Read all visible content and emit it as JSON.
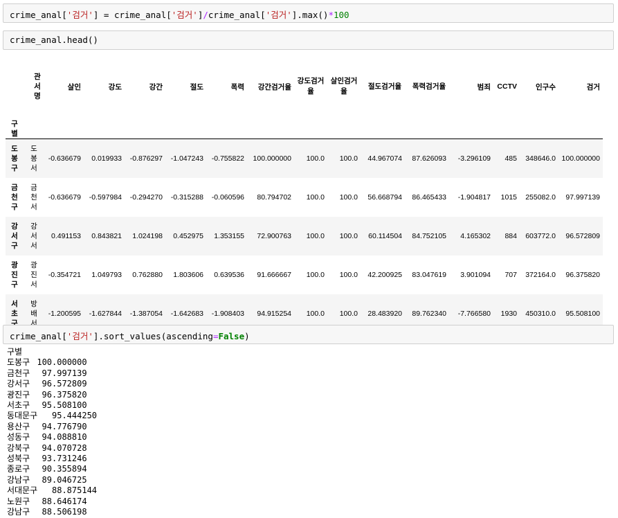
{
  "cells": {
    "cell1_code": {
      "var": "crime_anal",
      "key": "'검거'",
      "max_call": ".max()",
      "mult": "*",
      "num": "100"
    },
    "cell2_code": "crime_anal.head()",
    "cell3_code": {
      "var": "crime_anal",
      "key": "'검거'",
      "method": "].sort_values(ascending",
      "eq": "=",
      "kw": "False",
      "close": ")"
    }
  },
  "dataframe": {
    "index_name": "구별",
    "columns": [
      "관서명",
      "살인",
      "강도",
      "강간",
      "절도",
      "폭력",
      "강간검거율",
      "강도검거율",
      "살인검거율",
      "절도검거율",
      "폭력검거율",
      "범죄",
      "CCTV",
      "인구수",
      "검거"
    ],
    "rows": [
      [
        "도봉구",
        "도봉서",
        "-0.636679",
        "0.019933",
        "-0.876297",
        "-1.047243",
        "-0.755822",
        "100.000000",
        "100.0",
        "100.0",
        "44.967074",
        "87.626093",
        "-3.296109",
        "485",
        "348646.0",
        "100.000000"
      ],
      [
        "금천구",
        "금천서",
        "-0.636679",
        "-0.597984",
        "-0.294270",
        "-0.315288",
        "-0.060596",
        "80.794702",
        "100.0",
        "100.0",
        "56.668794",
        "86.465433",
        "-1.904817",
        "1015",
        "255082.0",
        "97.997139"
      ],
      [
        "강서구",
        "강서서",
        "0.491153",
        "0.843821",
        "1.024198",
        "0.452975",
        "1.353155",
        "72.900763",
        "100.0",
        "100.0",
        "60.114504",
        "84.752105",
        "4.165302",
        "884",
        "603772.0",
        "96.572809"
      ],
      [
        "광진구",
        "광진서",
        "-0.354721",
        "1.049793",
        "0.762880",
        "1.803606",
        "0.639536",
        "91.666667",
        "100.0",
        "100.0",
        "42.200925",
        "83.047619",
        "3.901094",
        "707",
        "372164.0",
        "96.375820"
      ],
      [
        "서초구",
        "방배서",
        "-1.200595",
        "-1.627844",
        "-1.387054",
        "-1.642683",
        "-1.908403",
        "94.915254",
        "100.0",
        "100.0",
        "28.483920",
        "89.762340",
        "-7.766580",
        "1930",
        "450310.0",
        "95.508100"
      ]
    ]
  },
  "series_output": {
    "index_name": "구별",
    "lines": [
      [
        "도봉구",
        "100.000000"
      ],
      [
        "금천구",
        "97.997139"
      ],
      [
        "강서구",
        "96.572809"
      ],
      [
        "광진구",
        "96.375820"
      ],
      [
        "서초구",
        "95.508100"
      ],
      [
        "동대문구",
        "95.444250"
      ],
      [
        "용산구",
        "94.776790"
      ],
      [
        "성동구",
        "94.088810"
      ],
      [
        "강북구",
        "94.070728"
      ],
      [
        "성북구",
        "93.731246"
      ],
      [
        "종로구",
        "90.355894"
      ],
      [
        "강남구",
        "89.046725"
      ],
      [
        "서대문구",
        "88.875144"
      ],
      [
        "노원구",
        "88.646174"
      ],
      [
        "강남구",
        "88.506198"
      ]
    ]
  }
}
